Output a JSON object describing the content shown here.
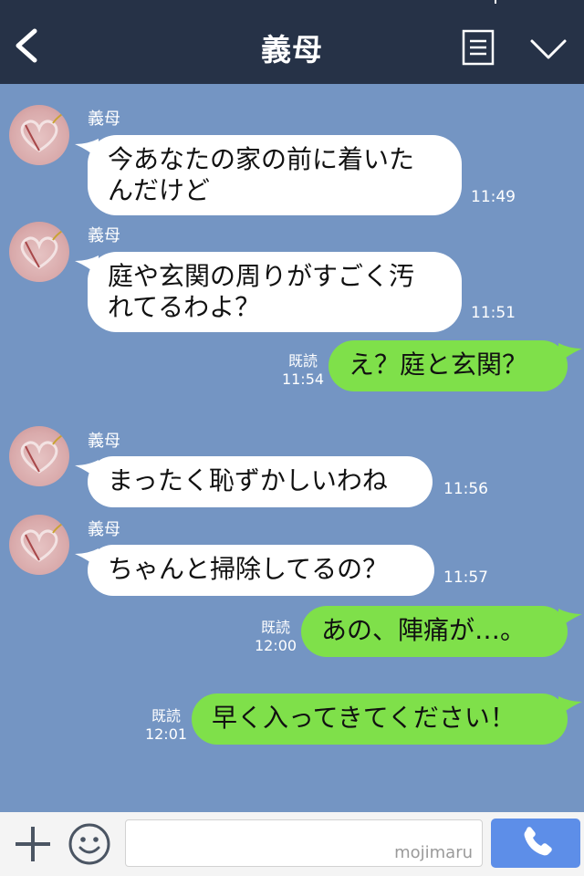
{
  "header": {
    "title": "義母"
  },
  "messages": [
    {
      "sender": "義母",
      "text": "今あなたの家の前に着いた\nんだけど",
      "time": "11:49"
    },
    {
      "sender": "義母",
      "text": "庭や玄関の周りがすごく汚\nれてるわよ？",
      "time": "11:51"
    },
    {
      "read": "既読",
      "text": "え？庭と玄関？",
      "time": "11:54"
    },
    {
      "sender": "義母",
      "text": "まったく恥ずかしいわね",
      "time": "11:56"
    },
    {
      "sender": "義母",
      "text": "ちゃんと掃除してるの？",
      "time": "11:57"
    },
    {
      "read": "既読",
      "text": "あの、陣痛が…。",
      "time": "12:00"
    },
    {
      "read": "既読",
      "text": "早く入ってきてください！",
      "time": "12:01"
    }
  ],
  "footer": {
    "watermark": "mojimaru"
  },
  "icons": [
    "back-icon",
    "menu-icon",
    "chevron-down-icon",
    "plus-icon",
    "smile-icon",
    "phone-icon",
    "avatar-heart-icon"
  ],
  "colors": {
    "header": "#263247",
    "background": "#7495c3",
    "incoming_bubble": "#ffffff",
    "outgoing_bubble": "#7fe04a",
    "call_button": "#5d8ee8"
  }
}
